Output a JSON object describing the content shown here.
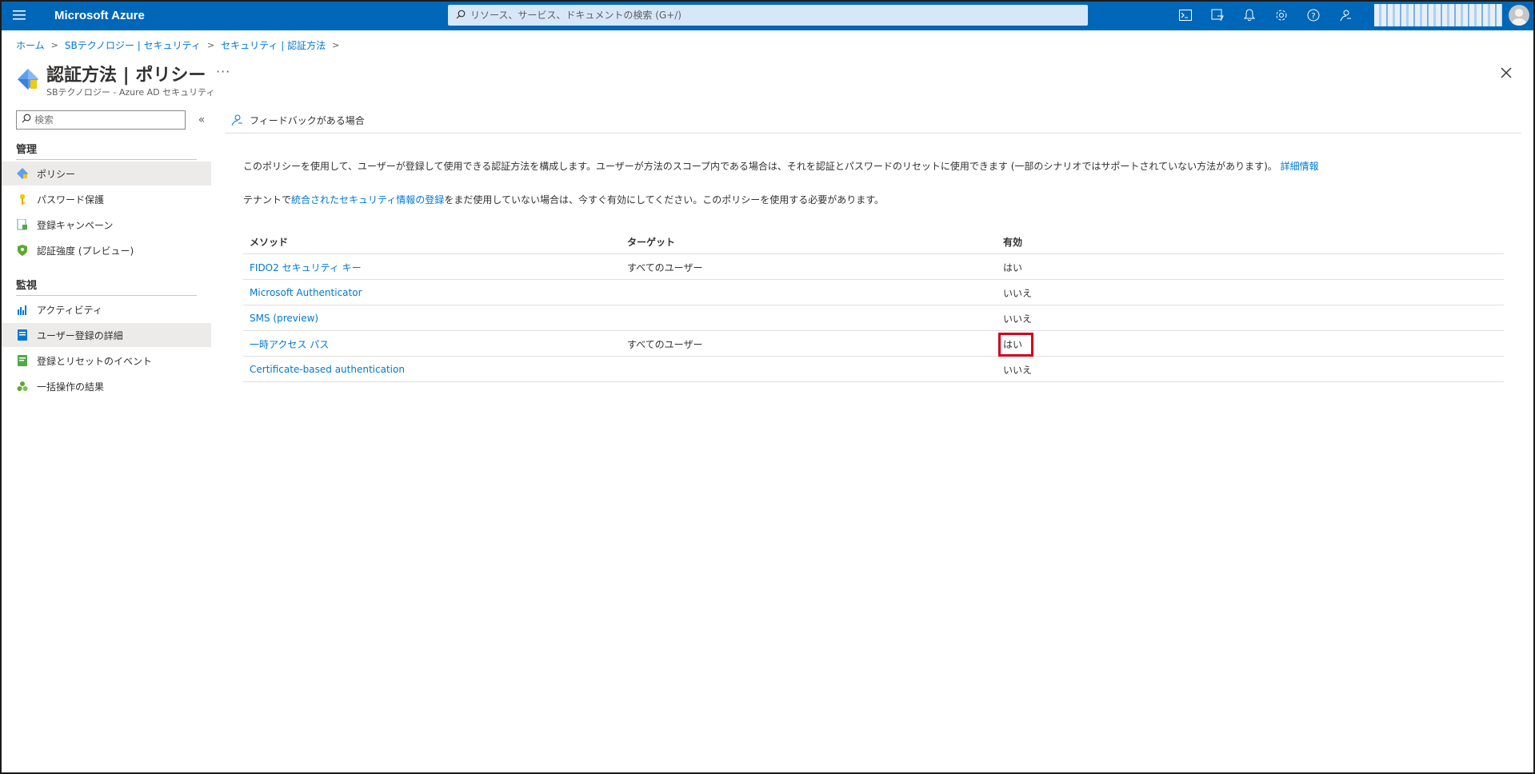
{
  "topbar": {
    "menu_icon": "hamburger-menu-icon",
    "brand": "Microsoft Azure",
    "search_placeholder": "リソース、サービス、ドキュメントの検索 (G+/)",
    "icons": [
      "cloud-shell-icon",
      "directory-filter-icon",
      "notifications-bell-icon",
      "settings-gear-icon",
      "help-question-icon",
      "feedback-icon"
    ]
  },
  "breadcrumb": {
    "items": [
      "ホーム",
      "SBテクノロジー | セキュリティ",
      "セキュリティ | 認証方法"
    ]
  },
  "page": {
    "title": "認証方法 | ポリシー",
    "subtitle": "SBテクノロジー - Azure AD セキュリティ",
    "more": "···"
  },
  "sidebar": {
    "search_placeholder": "検索",
    "collapse": "«",
    "sections": [
      {
        "title": "管理",
        "items": [
          {
            "label": "ポリシー",
            "icon": "policy-diamond-icon",
            "active": true
          },
          {
            "label": "パスワード保護",
            "icon": "key-icon",
            "active": false
          },
          {
            "label": "登録キャンペーン",
            "icon": "registration-campaign-icon",
            "active": false
          },
          {
            "label": "認証強度 (プレビュー)",
            "icon": "shield-icon",
            "active": false
          }
        ]
      },
      {
        "title": "監視",
        "items": [
          {
            "label": "アクティビティ",
            "icon": "activity-chart-icon",
            "active": false
          },
          {
            "label": "ユーザー登録の詳細",
            "icon": "user-registration-details-icon",
            "active": true
          },
          {
            "label": "登録とリセットのイベント",
            "icon": "events-log-icon",
            "active": false
          },
          {
            "label": "一括操作の結果",
            "icon": "bulk-operations-icon",
            "active": false
          }
        ]
      }
    ]
  },
  "main": {
    "feedback": "フィードバックがある場合",
    "description1": "このポリシーを使用して、ユーザーが登録して使用できる認証方法を構成します。ユーザーが方法のスコープ内である場合は、それを認証とパスワードのリセットに使用できます (一部のシナリオではサポートされていない方法があります)。",
    "description1_link": "詳細情報",
    "description2_prefix": "テナントで",
    "description2_link": "統合されたセキュリティ情報の登録",
    "description2_suffix": "をまだ使用していない場合は、今すぐ有効にしてください。このポリシーを使用する必要があります。",
    "table": {
      "headers": [
        "メソッド",
        "ターゲット",
        "有効"
      ],
      "rows": [
        {
          "method": "FIDO2 セキュリティ キー",
          "target": "すべてのユーザー",
          "enabled": "はい"
        },
        {
          "method": "Microsoft Authenticator",
          "target": "",
          "enabled": "いいえ"
        },
        {
          "method": "SMS (preview)",
          "target": "",
          "enabled": "いいえ"
        },
        {
          "method": "一時アクセス パス",
          "target": "すべてのユーザー",
          "enabled": "はい"
        },
        {
          "method": "Certificate-based authentication",
          "target": "",
          "enabled": "いいえ"
        }
      ]
    }
  },
  "colors": {
    "topbar": "#0067b8",
    "link": "#0078d4",
    "highlight_box": "#d0021b"
  }
}
